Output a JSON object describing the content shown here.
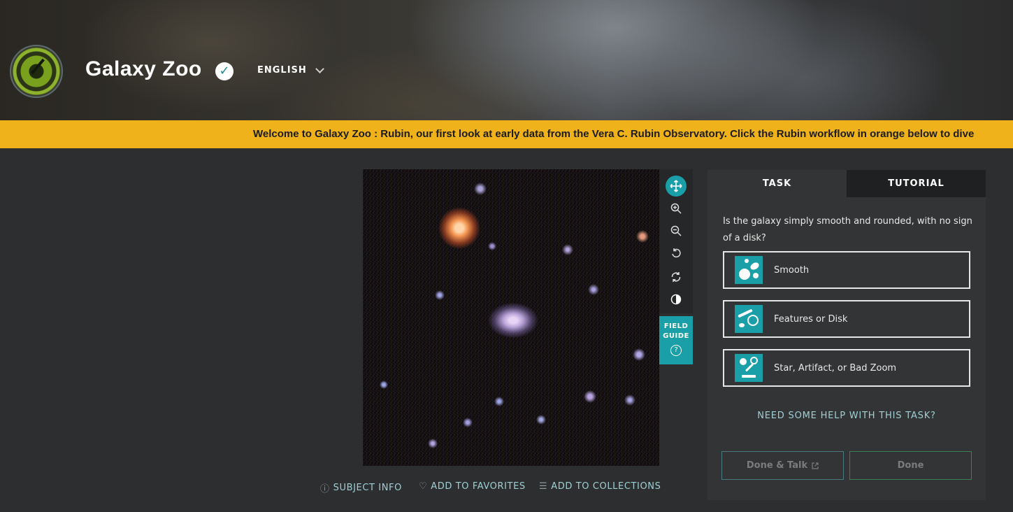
{
  "header": {
    "title": "Galaxy Zoo",
    "verified_icon": "checkmark-icon",
    "language": "ENGLISH"
  },
  "banner": {
    "text": "Welcome to Galaxy Zoo : Rubin, our first look at early data from the Vera C. Rubin Observatory. Click the Rubin workflow in orange below to dive"
  },
  "toolbar": {
    "tools": [
      "move-icon",
      "zoom-in-icon",
      "zoom-out-icon",
      "rotate-icon",
      "reset-icon",
      "invert-icon"
    ],
    "field_guide_label": "FIELD GUIDE",
    "field_guide_icon": "?"
  },
  "meta": {
    "subject_info": "SUBJECT INFO",
    "add_favorites": "ADD TO FAVORITES",
    "add_collections": "ADD TO COLLECTIONS"
  },
  "panel": {
    "tabs": [
      {
        "label": "TASK"
      },
      {
        "label": "TUTORIAL"
      }
    ],
    "question": "Is the galaxy simply smooth and rounded, with no sign of a disk?",
    "answers": [
      {
        "label": "Smooth",
        "icon": "smooth-galaxy-icon"
      },
      {
        "label": "Features or Disk",
        "icon": "disk-galaxy-icon"
      },
      {
        "label": "Star, Artifact, or Bad Zoom",
        "icon": "star-artifact-icon"
      }
    ],
    "help": "NEED SOME HELP WITH THIS TASK?",
    "done_talk": "Done & Talk",
    "done": "Done"
  },
  "colors": {
    "accent": "#1a9fa8",
    "banner": "#efb21a",
    "background": "#2d2e2f",
    "panel": "#333435",
    "link": "#9fd0d4"
  }
}
